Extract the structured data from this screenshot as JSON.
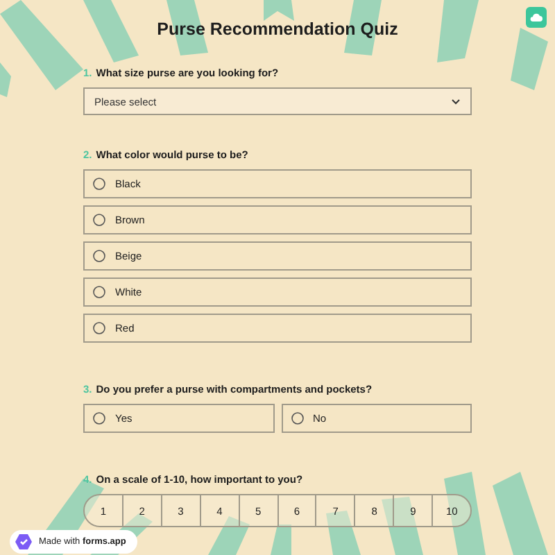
{
  "title": "Purse Recommendation Quiz",
  "questions": [
    {
      "kind": "select",
      "number": "1.",
      "label": "What size purse are you looking for?",
      "placeholder": "Please select"
    },
    {
      "kind": "radio-column",
      "number": "2.",
      "label": "What color would purse to be?",
      "options": [
        {
          "label": "Black",
          "selected": false
        },
        {
          "label": "Brown",
          "selected": false
        },
        {
          "label": "Beige",
          "selected": false
        },
        {
          "label": "White",
          "selected": false
        },
        {
          "label": "Red",
          "selected": false
        }
      ]
    },
    {
      "kind": "radio-row",
      "number": "3.",
      "label": "Do you prefer a purse with compartments and pockets?",
      "options": [
        {
          "label": "Yes",
          "selected": false
        },
        {
          "label": "No",
          "selected": false
        }
      ]
    },
    {
      "kind": "scale",
      "number": "4.",
      "label": "On a scale of 1-10, how important to you?",
      "options": [
        {
          "label": "1",
          "selected": false
        },
        {
          "label": "2",
          "selected": false
        },
        {
          "label": "3",
          "selected": false
        },
        {
          "label": "4",
          "selected": false
        },
        {
          "label": "5",
          "selected": false
        },
        {
          "label": "6",
          "selected": false
        },
        {
          "label": "7",
          "selected": false
        },
        {
          "label": "8",
          "selected": false
        },
        {
          "label": "9",
          "selected": false
        },
        {
          "label": "10",
          "selected": false
        }
      ]
    }
  ],
  "badge": "Made with **forms.app**"
}
